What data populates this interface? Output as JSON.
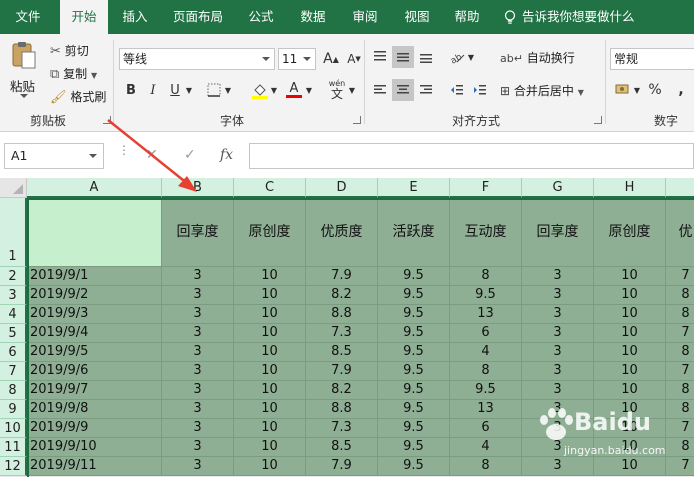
{
  "menu": {
    "tabs": [
      "文件",
      "开始",
      "插入",
      "页面布局",
      "公式",
      "数据",
      "审阅",
      "视图",
      "帮助"
    ],
    "active": "开始",
    "tell_me": "告诉我你想要做什么"
  },
  "ribbon": {
    "clipboard": {
      "paste": "粘贴",
      "cut": "剪切",
      "copy": "复制",
      "format_painter": "格式刷",
      "label": "剪贴板"
    },
    "font": {
      "name": "等线",
      "size": "11",
      "grow": "A",
      "shrink": "A",
      "bold": "B",
      "italic": "I",
      "underline": "U",
      "wen": "wén",
      "wen_char": "文",
      "label": "字体"
    },
    "alignment": {
      "wrap": "自动换行",
      "merge": "合并后居中",
      "label": "对齐方式"
    },
    "number": {
      "format": "常规",
      "percent": "%",
      "label": "数字"
    }
  },
  "formula_bar": {
    "name_box": "A1",
    "fx": "fx",
    "cancel": "✕",
    "enter": "✓",
    "value": ""
  },
  "columns": [
    "A",
    "B",
    "C",
    "D",
    "E",
    "F",
    "G",
    "H"
  ],
  "header_row": [
    "",
    "回享度",
    "原创度",
    "优质度",
    "活跃度",
    "互动度",
    "回享度",
    "原创度",
    "优"
  ],
  "rows": [
    {
      "n": "1"
    },
    {
      "n": "2",
      "cells": [
        "2019/9/1",
        "3",
        "10",
        "7.9",
        "9.5",
        "8",
        "3",
        "10",
        "7"
      ]
    },
    {
      "n": "3",
      "cells": [
        "2019/9/2",
        "3",
        "10",
        "8.2",
        "9.5",
        "9.5",
        "3",
        "10",
        "8"
      ]
    },
    {
      "n": "4",
      "cells": [
        "2019/9/3",
        "3",
        "10",
        "8.8",
        "9.5",
        "13",
        "3",
        "10",
        "8"
      ]
    },
    {
      "n": "5",
      "cells": [
        "2019/9/4",
        "3",
        "10",
        "7.3",
        "9.5",
        "6",
        "3",
        "10",
        "7"
      ]
    },
    {
      "n": "6",
      "cells": [
        "2019/9/5",
        "3",
        "10",
        "8.5",
        "9.5",
        "4",
        "3",
        "10",
        "8"
      ]
    },
    {
      "n": "7",
      "cells": [
        "2019/9/6",
        "3",
        "10",
        "7.9",
        "9.5",
        "8",
        "3",
        "10",
        "7"
      ]
    },
    {
      "n": "8",
      "cells": [
        "2019/9/7",
        "3",
        "10",
        "8.2",
        "9.5",
        "9.5",
        "3",
        "10",
        "8"
      ]
    },
    {
      "n": "9",
      "cells": [
        "2019/9/8",
        "3",
        "10",
        "8.8",
        "9.5",
        "13",
        "3",
        "10",
        "8"
      ]
    },
    {
      "n": "10",
      "cells": [
        "2019/9/9",
        "3",
        "10",
        "7.3",
        "9.5",
        "6",
        "3",
        "10",
        "7"
      ]
    },
    {
      "n": "11",
      "cells": [
        "2019/9/10",
        "3",
        "10",
        "8.5",
        "9.5",
        "4",
        "3",
        "10",
        "8"
      ]
    },
    {
      "n": "12",
      "cells": [
        "2019/9/11",
        "3",
        "10",
        "7.9",
        "9.5",
        "8",
        "3",
        "10",
        "7"
      ]
    }
  ],
  "watermark": {
    "brand": "Baidu",
    "site": "jingyan.baidu.com"
  },
  "colors": {
    "brand_green": "#217346",
    "selection_fill": "#8faf95",
    "active_cell": "#c6efce",
    "arrow": "#e8402f"
  }
}
